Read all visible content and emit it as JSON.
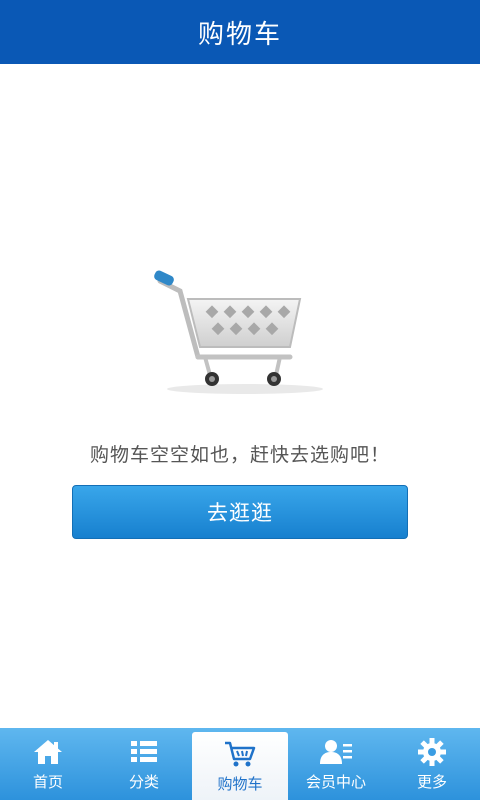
{
  "header": {
    "title": "购物车"
  },
  "cart": {
    "empty_message": "购物车空空如也，赶快去选购吧！",
    "go_shopping_label": "去逛逛"
  },
  "tabbar": {
    "items": [
      {
        "label": "首页",
        "icon": "home-icon"
      },
      {
        "label": "分类",
        "icon": "list-icon"
      },
      {
        "label": "购物车",
        "icon": "cart-icon",
        "active": true
      },
      {
        "label": "会员中心",
        "icon": "member-icon"
      },
      {
        "label": "更多",
        "icon": "gear-icon"
      }
    ]
  },
  "colors": {
    "header_bg": "#0a58b5",
    "tabbar_bg": "#2d92dc",
    "button_bg": "#1780cf",
    "active_tab_text": "#1f72c9"
  }
}
